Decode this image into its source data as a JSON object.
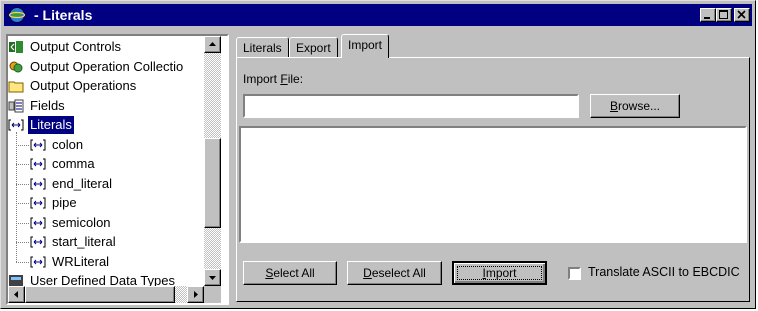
{
  "window": {
    "title": "- Literals",
    "app_icon": "globe-icon",
    "controls": [
      "minimize-icon",
      "maximize-icon",
      "close-icon"
    ]
  },
  "tree": {
    "items": [
      {
        "label": "Output Controls",
        "icon": "output-controls-icon",
        "depth": 0,
        "selected": false
      },
      {
        "label": "Output Operation Collectio",
        "icon": "operation-collection-icon",
        "depth": 0,
        "selected": false
      },
      {
        "label": "Output Operations",
        "icon": "folder-icon",
        "depth": 0,
        "selected": false
      },
      {
        "label": "Fields",
        "icon": "fields-icon",
        "depth": 0,
        "selected": false
      },
      {
        "label": "Literals",
        "icon": "literal-icon",
        "depth": 0,
        "selected": true
      },
      {
        "label": "colon",
        "icon": "literal-icon",
        "depth": 1,
        "selected": false
      },
      {
        "label": "comma",
        "icon": "literal-icon",
        "depth": 1,
        "selected": false
      },
      {
        "label": "end_literal",
        "icon": "literal-icon",
        "depth": 1,
        "selected": false
      },
      {
        "label": "pipe",
        "icon": "literal-icon",
        "depth": 1,
        "selected": false
      },
      {
        "label": "semicolon",
        "icon": "literal-icon",
        "depth": 1,
        "selected": false
      },
      {
        "label": "start_literal",
        "icon": "literal-icon",
        "depth": 1,
        "selected": false
      },
      {
        "label": "WRLiteral",
        "icon": "literal-icon",
        "depth": 1,
        "selected": false
      },
      {
        "label": "User Defined Data Types",
        "icon": "data-types-icon",
        "depth": 0,
        "selected": false
      }
    ]
  },
  "tabs": [
    {
      "label": "Literals",
      "active": false
    },
    {
      "label": "Export",
      "active": false
    },
    {
      "label": "Import",
      "active": true
    }
  ],
  "import_panel": {
    "file_label_prefix": "Import ",
    "file_label_mnemonic": "F",
    "file_label_suffix": "ile:",
    "file_value": "",
    "browse_mnemonic": "B",
    "browse_rest": "rowse...",
    "select_all_mnemonic": "S",
    "select_all_rest": "elect All",
    "deselect_all_mnemonic": "D",
    "deselect_all_rest": "eselect All",
    "import_mnemonic": "I",
    "import_rest": "mport",
    "translate_label": "Translate ASCII to EBCDIC",
    "translate_checked": false
  },
  "colors": {
    "titlebar": "#000080",
    "face": "#c0c0c0",
    "selection": "#000080"
  }
}
